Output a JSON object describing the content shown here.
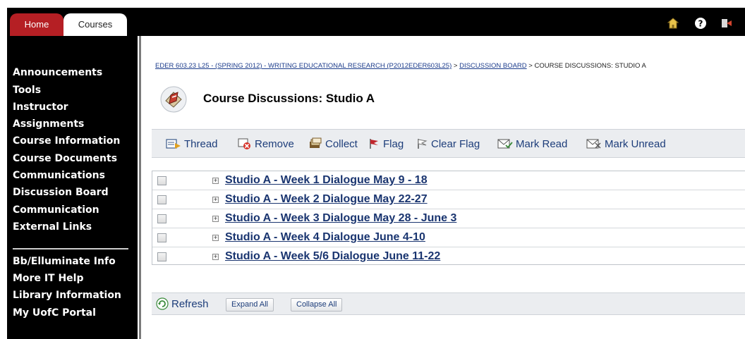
{
  "tabs": [
    {
      "label": "Home",
      "active": false
    },
    {
      "label": "Courses",
      "active": true
    }
  ],
  "header_icons": [
    "home-icon",
    "help-icon",
    "logout-icon"
  ],
  "sidebar": {
    "items": [
      {
        "label": "Announcements"
      },
      {
        "label": "Tools"
      },
      {
        "label": "Instructor"
      },
      {
        "label": "Assignments"
      },
      {
        "label": "Course Information"
      },
      {
        "label": "Course Documents"
      },
      {
        "label": "Communications"
      },
      {
        "label": "Discussion Board"
      },
      {
        "label": "Communication"
      },
      {
        "label": "External Links"
      }
    ],
    "secondary_items": [
      {
        "label": "Bb/Elluminate Info"
      },
      {
        "label": "More IT Help"
      },
      {
        "label": "Library Information"
      },
      {
        "label": "My UofC Portal"
      }
    ]
  },
  "breadcrumb": {
    "course": "EDER 603.23 L25 - (SPRING 2012) - WRITING EDUCATIONAL RESEARCH (P2012EDER603L25)",
    "sep1": " > ",
    "board": "DISCUSSION BOARD",
    "sep2": " > ",
    "current": "COURSE DISCUSSIONS: STUDIO A"
  },
  "page": {
    "title": "Course Discussions: Studio A"
  },
  "toolbar": {
    "buttons": [
      {
        "label": "Thread",
        "icon": "new-thread-icon"
      },
      {
        "label": "Remove",
        "icon": "remove-icon"
      },
      {
        "label": "Collect",
        "icon": "collect-icon"
      },
      {
        "label": "Flag",
        "icon": "flag-icon"
      },
      {
        "label": "Clear Flag",
        "icon": "clear-flag-icon"
      },
      {
        "label": "Mark Read",
        "icon": "mark-read-icon"
      },
      {
        "label": "Mark Unread",
        "icon": "mark-unread-icon"
      }
    ]
  },
  "threads": [
    {
      "title": "Studio A - Week 1 Dialogue May 9 - 18"
    },
    {
      "title": "Studio A - Week 2 Dialogue May 22-27"
    },
    {
      "title": "Studio A - Week 3 Dialogue May 28 - June 3"
    },
    {
      "title": "Studio A - Week 4 Dialogue June 4-10"
    },
    {
      "title": "Studio A - Week 5/6 Dialogue June 11-22"
    }
  ],
  "bottombar": {
    "refresh_label": "Refresh",
    "expand_all_label": "Expand All",
    "collapse_all_label": "Collapse All"
  },
  "colors": {
    "home_tab": "#b51f24",
    "header_bg": "#000000",
    "link": "#1a3570",
    "toolbar_bg": "#ebedf0"
  }
}
